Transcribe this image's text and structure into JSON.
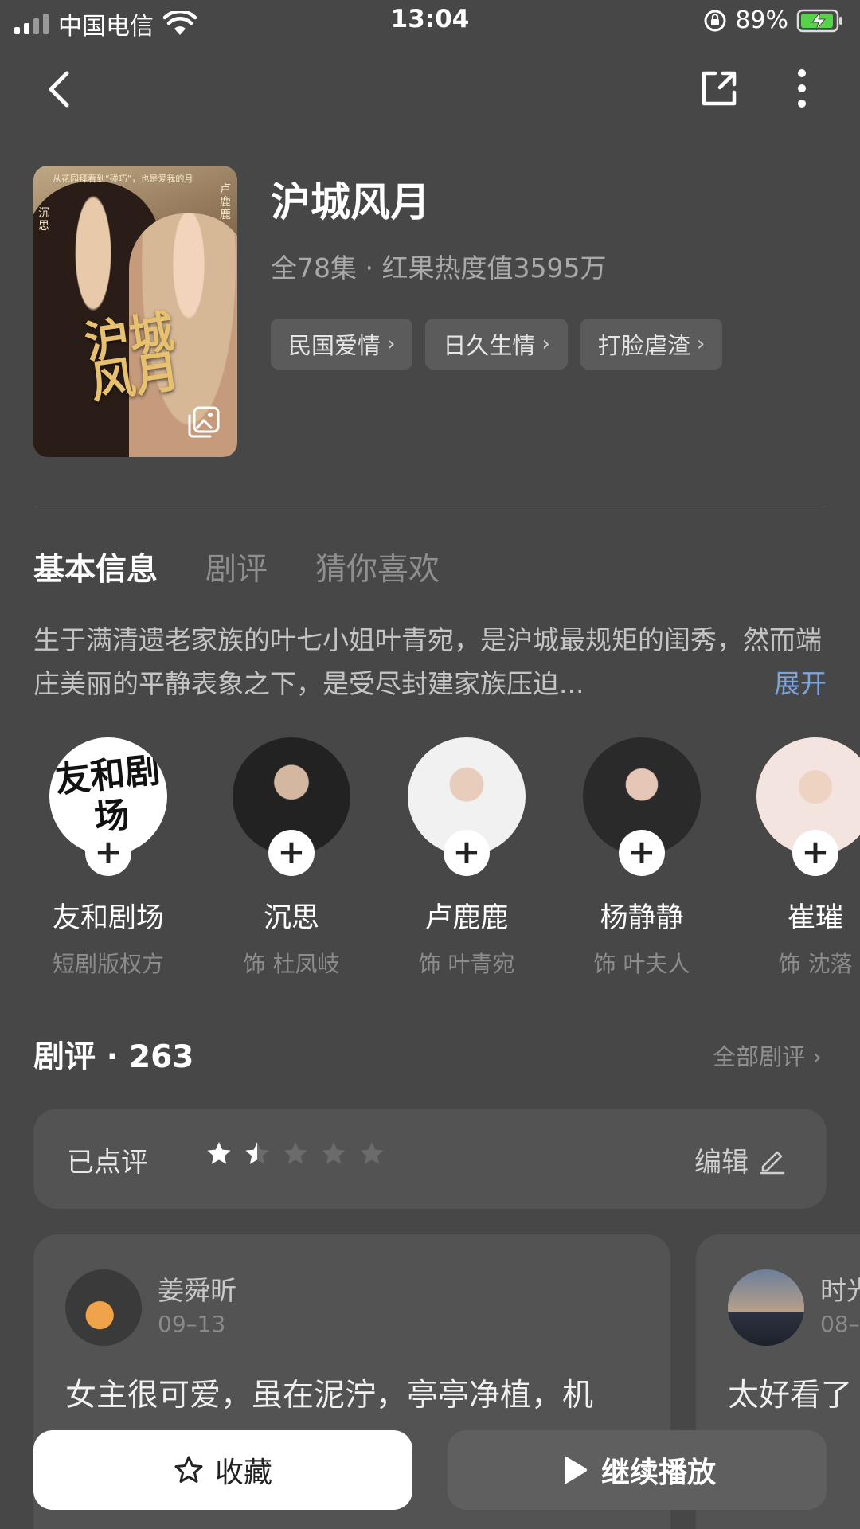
{
  "status_bar": {
    "carrier": "中国电信",
    "time": "13:04",
    "battery": "89%"
  },
  "show": {
    "title": "沪城风月",
    "meta": "全78集 · 红果热度值3595万",
    "tags": [
      "民国爱情",
      "日久生情",
      "打脸虐渣"
    ],
    "poster": {
      "title_art": "沪城风月",
      "tagline": "从花园拜看到“碰巧”，也是爱我的月",
      "name_left": "沉思",
      "name_right": "卢鹿鹿"
    }
  },
  "tabs": [
    "基本信息",
    "剧评",
    "猜你喜欢"
  ],
  "synopsis": {
    "text": "生于满清遗老家族的叶七小姐叶青宛，是沪城最规矩的闺秀，然而端庄美丽的平静表象之下，是受尽封建家族压迫...",
    "expand": "展开"
  },
  "cast": [
    {
      "name": "友和剧场",
      "role": "短剧版权方",
      "logo": "友和剧场"
    },
    {
      "name": "沉思",
      "role": "饰 杜凤岐"
    },
    {
      "name": "卢鹿鹿",
      "role": "饰 叶青宛"
    },
    {
      "name": "杨静静",
      "role": "饰 叶夫人"
    },
    {
      "name": "崔璀",
      "role": "饰 沈落"
    }
  ],
  "reviews": {
    "heading": "剧评 · 263",
    "all_label": "全部剧评",
    "my_rating_label": "已点评",
    "my_rating_value": 1.5,
    "edit_label": "编辑",
    "items": [
      {
        "user": "姜舜昕",
        "date": "09–13",
        "text": "女主很可爱，虽在泥泞，亭亭净植，机"
      },
      {
        "user": "时光",
        "date": "08–",
        "text": "太好看了"
      }
    ]
  },
  "actions": {
    "favorite": "收藏",
    "play": "继续播放"
  }
}
